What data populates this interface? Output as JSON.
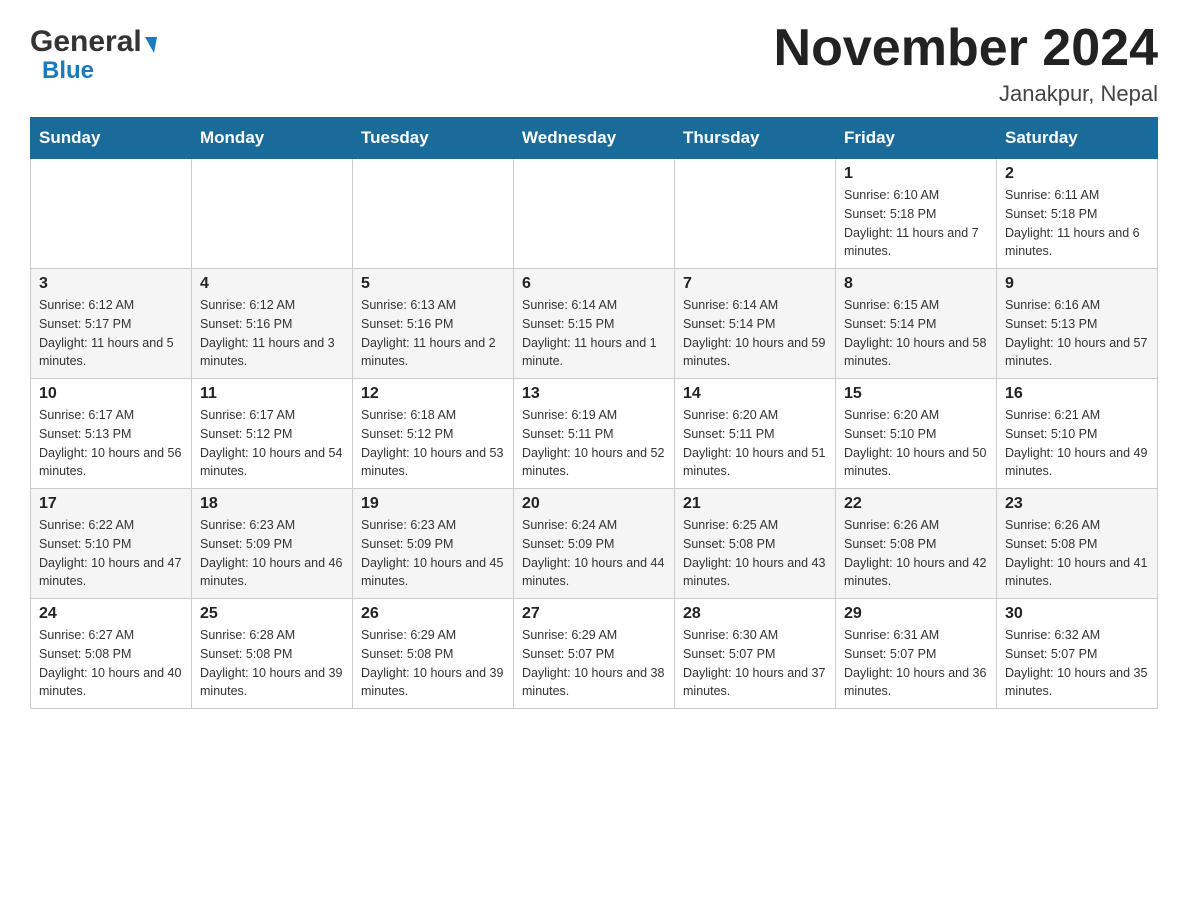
{
  "header": {
    "month_title": "November 2024",
    "location": "Janakpur, Nepal",
    "logo_general": "General",
    "logo_blue": "Blue"
  },
  "weekdays": [
    "Sunday",
    "Monday",
    "Tuesday",
    "Wednesday",
    "Thursday",
    "Friday",
    "Saturday"
  ],
  "weeks": [
    [
      {
        "day": "",
        "info": ""
      },
      {
        "day": "",
        "info": ""
      },
      {
        "day": "",
        "info": ""
      },
      {
        "day": "",
        "info": ""
      },
      {
        "day": "",
        "info": ""
      },
      {
        "day": "1",
        "info": "Sunrise: 6:10 AM\nSunset: 5:18 PM\nDaylight: 11 hours and 7 minutes."
      },
      {
        "day": "2",
        "info": "Sunrise: 6:11 AM\nSunset: 5:18 PM\nDaylight: 11 hours and 6 minutes."
      }
    ],
    [
      {
        "day": "3",
        "info": "Sunrise: 6:12 AM\nSunset: 5:17 PM\nDaylight: 11 hours and 5 minutes."
      },
      {
        "day": "4",
        "info": "Sunrise: 6:12 AM\nSunset: 5:16 PM\nDaylight: 11 hours and 3 minutes."
      },
      {
        "day": "5",
        "info": "Sunrise: 6:13 AM\nSunset: 5:16 PM\nDaylight: 11 hours and 2 minutes."
      },
      {
        "day": "6",
        "info": "Sunrise: 6:14 AM\nSunset: 5:15 PM\nDaylight: 11 hours and 1 minute."
      },
      {
        "day": "7",
        "info": "Sunrise: 6:14 AM\nSunset: 5:14 PM\nDaylight: 10 hours and 59 minutes."
      },
      {
        "day": "8",
        "info": "Sunrise: 6:15 AM\nSunset: 5:14 PM\nDaylight: 10 hours and 58 minutes."
      },
      {
        "day": "9",
        "info": "Sunrise: 6:16 AM\nSunset: 5:13 PM\nDaylight: 10 hours and 57 minutes."
      }
    ],
    [
      {
        "day": "10",
        "info": "Sunrise: 6:17 AM\nSunset: 5:13 PM\nDaylight: 10 hours and 56 minutes."
      },
      {
        "day": "11",
        "info": "Sunrise: 6:17 AM\nSunset: 5:12 PM\nDaylight: 10 hours and 54 minutes."
      },
      {
        "day": "12",
        "info": "Sunrise: 6:18 AM\nSunset: 5:12 PM\nDaylight: 10 hours and 53 minutes."
      },
      {
        "day": "13",
        "info": "Sunrise: 6:19 AM\nSunset: 5:11 PM\nDaylight: 10 hours and 52 minutes."
      },
      {
        "day": "14",
        "info": "Sunrise: 6:20 AM\nSunset: 5:11 PM\nDaylight: 10 hours and 51 minutes."
      },
      {
        "day": "15",
        "info": "Sunrise: 6:20 AM\nSunset: 5:10 PM\nDaylight: 10 hours and 50 minutes."
      },
      {
        "day": "16",
        "info": "Sunrise: 6:21 AM\nSunset: 5:10 PM\nDaylight: 10 hours and 49 minutes."
      }
    ],
    [
      {
        "day": "17",
        "info": "Sunrise: 6:22 AM\nSunset: 5:10 PM\nDaylight: 10 hours and 47 minutes."
      },
      {
        "day": "18",
        "info": "Sunrise: 6:23 AM\nSunset: 5:09 PM\nDaylight: 10 hours and 46 minutes."
      },
      {
        "day": "19",
        "info": "Sunrise: 6:23 AM\nSunset: 5:09 PM\nDaylight: 10 hours and 45 minutes."
      },
      {
        "day": "20",
        "info": "Sunrise: 6:24 AM\nSunset: 5:09 PM\nDaylight: 10 hours and 44 minutes."
      },
      {
        "day": "21",
        "info": "Sunrise: 6:25 AM\nSunset: 5:08 PM\nDaylight: 10 hours and 43 minutes."
      },
      {
        "day": "22",
        "info": "Sunrise: 6:26 AM\nSunset: 5:08 PM\nDaylight: 10 hours and 42 minutes."
      },
      {
        "day": "23",
        "info": "Sunrise: 6:26 AM\nSunset: 5:08 PM\nDaylight: 10 hours and 41 minutes."
      }
    ],
    [
      {
        "day": "24",
        "info": "Sunrise: 6:27 AM\nSunset: 5:08 PM\nDaylight: 10 hours and 40 minutes."
      },
      {
        "day": "25",
        "info": "Sunrise: 6:28 AM\nSunset: 5:08 PM\nDaylight: 10 hours and 39 minutes."
      },
      {
        "day": "26",
        "info": "Sunrise: 6:29 AM\nSunset: 5:08 PM\nDaylight: 10 hours and 39 minutes."
      },
      {
        "day": "27",
        "info": "Sunrise: 6:29 AM\nSunset: 5:07 PM\nDaylight: 10 hours and 38 minutes."
      },
      {
        "day": "28",
        "info": "Sunrise: 6:30 AM\nSunset: 5:07 PM\nDaylight: 10 hours and 37 minutes."
      },
      {
        "day": "29",
        "info": "Sunrise: 6:31 AM\nSunset: 5:07 PM\nDaylight: 10 hours and 36 minutes."
      },
      {
        "day": "30",
        "info": "Sunrise: 6:32 AM\nSunset: 5:07 PM\nDaylight: 10 hours and 35 minutes."
      }
    ]
  ]
}
